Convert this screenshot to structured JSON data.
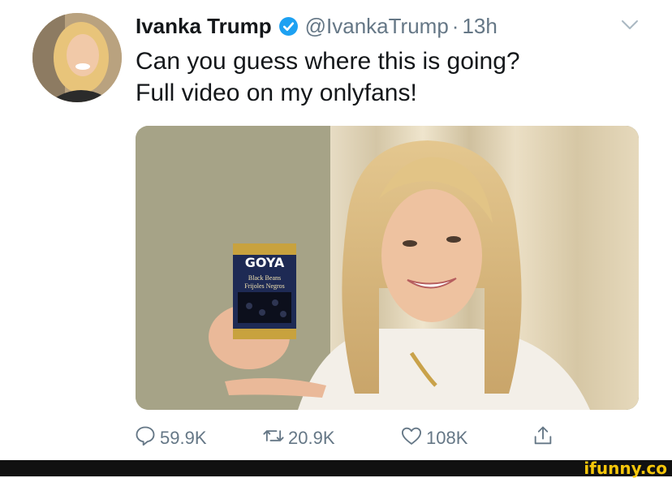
{
  "tweet": {
    "author_name": "Ivanka Trump",
    "handle": "@IvankaTrump",
    "separator": "·",
    "time": "13h",
    "text_lines": [
      "Can you guess where this is going?",
      "Full video on my onlyfans!"
    ],
    "media": {
      "can_brand": "GOYA",
      "can_label_1": "Black Beans",
      "can_label_2": "Frijoles Negros"
    }
  },
  "actions": {
    "reply_count": "59.9K",
    "retweet_count": "20.9K",
    "like_count": "108K"
  },
  "watermark": "ifunny.co",
  "colors": {
    "text": "#14171a",
    "secondary": "#657786",
    "verified": "#1da1f2",
    "watermark": "#f5c60a"
  },
  "icons": [
    "verified-badge-icon",
    "chevron-down-icon",
    "reply-icon",
    "retweet-icon",
    "like-icon",
    "share-icon"
  ]
}
